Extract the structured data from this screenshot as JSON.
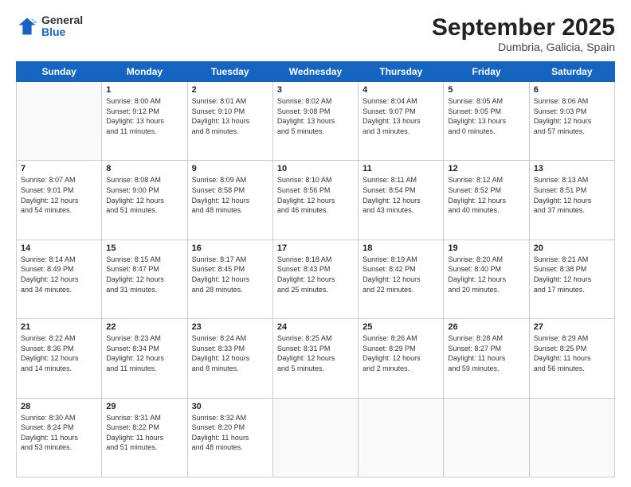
{
  "header": {
    "logo": {
      "line1": "General",
      "line2": "Blue"
    },
    "title": "September 2025",
    "location": "Dumbria, Galicia, Spain"
  },
  "weekdays": [
    "Sunday",
    "Monday",
    "Tuesday",
    "Wednesday",
    "Thursday",
    "Friday",
    "Saturday"
  ],
  "weeks": [
    [
      {
        "day": "",
        "info": ""
      },
      {
        "day": "1",
        "info": "Sunrise: 8:00 AM\nSunset: 9:12 PM\nDaylight: 13 hours\nand 11 minutes."
      },
      {
        "day": "2",
        "info": "Sunrise: 8:01 AM\nSunset: 9:10 PM\nDaylight: 13 hours\nand 8 minutes."
      },
      {
        "day": "3",
        "info": "Sunrise: 8:02 AM\nSunset: 9:08 PM\nDaylight: 13 hours\nand 5 minutes."
      },
      {
        "day": "4",
        "info": "Sunrise: 8:04 AM\nSunset: 9:07 PM\nDaylight: 13 hours\nand 3 minutes."
      },
      {
        "day": "5",
        "info": "Sunrise: 8:05 AM\nSunset: 9:05 PM\nDaylight: 13 hours\nand 0 minutes."
      },
      {
        "day": "6",
        "info": "Sunrise: 8:06 AM\nSunset: 9:03 PM\nDaylight: 12 hours\nand 57 minutes."
      }
    ],
    [
      {
        "day": "7",
        "info": "Sunrise: 8:07 AM\nSunset: 9:01 PM\nDaylight: 12 hours\nand 54 minutes."
      },
      {
        "day": "8",
        "info": "Sunrise: 8:08 AM\nSunset: 9:00 PM\nDaylight: 12 hours\nand 51 minutes."
      },
      {
        "day": "9",
        "info": "Sunrise: 8:09 AM\nSunset: 8:58 PM\nDaylight: 12 hours\nand 48 minutes."
      },
      {
        "day": "10",
        "info": "Sunrise: 8:10 AM\nSunset: 8:56 PM\nDaylight: 12 hours\nand 46 minutes."
      },
      {
        "day": "11",
        "info": "Sunrise: 8:11 AM\nSunset: 8:54 PM\nDaylight: 12 hours\nand 43 minutes."
      },
      {
        "day": "12",
        "info": "Sunrise: 8:12 AM\nSunset: 8:52 PM\nDaylight: 12 hours\nand 40 minutes."
      },
      {
        "day": "13",
        "info": "Sunrise: 8:13 AM\nSunset: 8:51 PM\nDaylight: 12 hours\nand 37 minutes."
      }
    ],
    [
      {
        "day": "14",
        "info": "Sunrise: 8:14 AM\nSunset: 8:49 PM\nDaylight: 12 hours\nand 34 minutes."
      },
      {
        "day": "15",
        "info": "Sunrise: 8:15 AM\nSunset: 8:47 PM\nDaylight: 12 hours\nand 31 minutes."
      },
      {
        "day": "16",
        "info": "Sunrise: 8:17 AM\nSunset: 8:45 PM\nDaylight: 12 hours\nand 28 minutes."
      },
      {
        "day": "17",
        "info": "Sunrise: 8:18 AM\nSunset: 8:43 PM\nDaylight: 12 hours\nand 25 minutes."
      },
      {
        "day": "18",
        "info": "Sunrise: 8:19 AM\nSunset: 8:42 PM\nDaylight: 12 hours\nand 22 minutes."
      },
      {
        "day": "19",
        "info": "Sunrise: 8:20 AM\nSunset: 8:40 PM\nDaylight: 12 hours\nand 20 minutes."
      },
      {
        "day": "20",
        "info": "Sunrise: 8:21 AM\nSunset: 8:38 PM\nDaylight: 12 hours\nand 17 minutes."
      }
    ],
    [
      {
        "day": "21",
        "info": "Sunrise: 8:22 AM\nSunset: 8:36 PM\nDaylight: 12 hours\nand 14 minutes."
      },
      {
        "day": "22",
        "info": "Sunrise: 8:23 AM\nSunset: 8:34 PM\nDaylight: 12 hours\nand 11 minutes."
      },
      {
        "day": "23",
        "info": "Sunrise: 8:24 AM\nSunset: 8:33 PM\nDaylight: 12 hours\nand 8 minutes."
      },
      {
        "day": "24",
        "info": "Sunrise: 8:25 AM\nSunset: 8:31 PM\nDaylight: 12 hours\nand 5 minutes."
      },
      {
        "day": "25",
        "info": "Sunrise: 8:26 AM\nSunset: 8:29 PM\nDaylight: 12 hours\nand 2 minutes."
      },
      {
        "day": "26",
        "info": "Sunrise: 8:28 AM\nSunset: 8:27 PM\nDaylight: 11 hours\nand 59 minutes."
      },
      {
        "day": "27",
        "info": "Sunrise: 8:29 AM\nSunset: 8:25 PM\nDaylight: 11 hours\nand 56 minutes."
      }
    ],
    [
      {
        "day": "28",
        "info": "Sunrise: 8:30 AM\nSunset: 8:24 PM\nDaylight: 11 hours\nand 53 minutes."
      },
      {
        "day": "29",
        "info": "Sunrise: 8:31 AM\nSunset: 8:22 PM\nDaylight: 11 hours\nand 51 minutes."
      },
      {
        "day": "30",
        "info": "Sunrise: 8:32 AM\nSunset: 8:20 PM\nDaylight: 11 hours\nand 48 minutes."
      },
      {
        "day": "",
        "info": ""
      },
      {
        "day": "",
        "info": ""
      },
      {
        "day": "",
        "info": ""
      },
      {
        "day": "",
        "info": ""
      }
    ]
  ]
}
